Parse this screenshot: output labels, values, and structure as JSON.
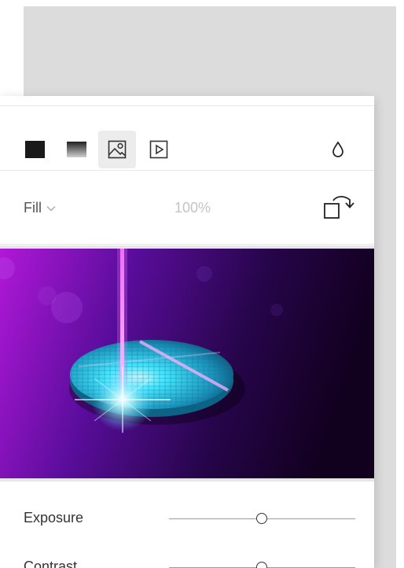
{
  "toolbar": {
    "tools": [
      {
        "name": "solid-fill",
        "icon": "solid-square-icon"
      },
      {
        "name": "gradient-fill",
        "icon": "gradient-square-icon"
      },
      {
        "name": "image-fill",
        "icon": "image-icon",
        "active": true
      },
      {
        "name": "video-fill",
        "icon": "play-icon"
      }
    ],
    "blend_icon": "droplet-icon"
  },
  "fill": {
    "mode_label": "Fill",
    "opacity": "100%",
    "rotate_icon": "rotate-icon"
  },
  "preview": {
    "image_icon": "laser-wafer-image",
    "colors": {
      "bg_left": "#b018d8",
      "bg_right": "#12001f",
      "beam": "#ff70ff",
      "disc": "#2ad6ee"
    }
  },
  "adjustments": [
    {
      "label": "Exposure",
      "value": 0.5
    },
    {
      "label": "Contrast",
      "value": 0.5
    }
  ]
}
